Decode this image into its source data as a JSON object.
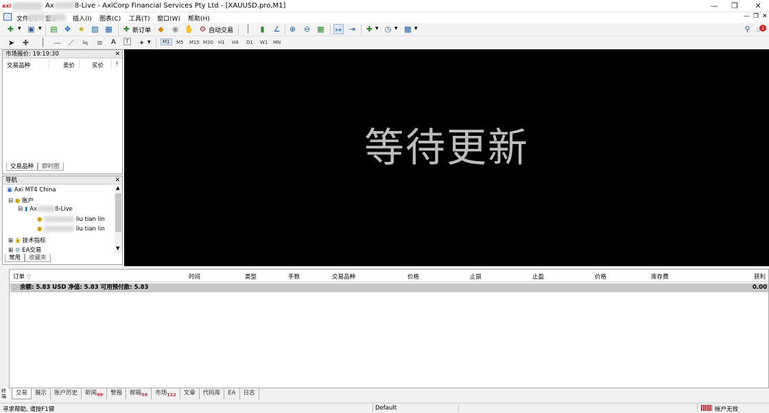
{
  "window": {
    "title": "Axi ... 8-Live - AxiCorp Financial Services Pty Ltd - [XAUUSD.pro,M1]",
    "title_visible": "8-Live - AxiCorp Financial Services Pty Ltd - [XAUUSD.pro,M1]",
    "title_prefix": "Ax",
    "app_logo": "axi"
  },
  "menu": {
    "items": [
      "文件(F)",
      "显示",
      "插入(I)",
      "图表(C)",
      "工具(T)",
      "窗口(W)",
      "帮助(H)"
    ]
  },
  "toolbar": {
    "new_order": "新订单",
    "auto_trade": "自动交易",
    "timeframes": [
      "M1",
      "M5",
      "M15",
      "M30",
      "H1",
      "H4",
      "D1",
      "W1",
      "MN"
    ],
    "notification_count": "1",
    "text_tool": "A"
  },
  "market_watch": {
    "title": "市场报价: 19:19:30",
    "columns": [
      "交易品种",
      "卖价",
      "买价",
      "!"
    ],
    "tabs": [
      "交易品种",
      "即时图"
    ]
  },
  "navigator": {
    "title": "导航",
    "root": "Axi MT4 China",
    "accounts_label": "账户",
    "account_name_suffix": "8-Live",
    "account_prefix": "Ax",
    "users": [
      "liu tian lin",
      "liu tian lin"
    ],
    "indicators": "技术指标",
    "ea": "EA交易",
    "tabs": [
      "常用",
      "收藏夹"
    ]
  },
  "chart": {
    "waiting_text": "等待更新"
  },
  "terminal": {
    "columns": [
      "订单",
      "时间",
      "类型",
      "手数",
      "交易品种",
      "价格",
      "止损",
      "止盈",
      "价格",
      "库存费",
      "获利"
    ],
    "balance_line": "余额: 5.83 USD  净值: 5.83  可用预付款: 5.83",
    "profit": "0.00",
    "side_label": "终端",
    "tabs": [
      {
        "label": "交易",
        "badge": ""
      },
      {
        "label": "展示",
        "badge": ""
      },
      {
        "label": "账户历史",
        "badge": ""
      },
      {
        "label": "新闻",
        "badge": "99"
      },
      {
        "label": "警报",
        "badge": ""
      },
      {
        "label": "邮箱",
        "badge": "59"
      },
      {
        "label": "市场",
        "badge": "112"
      },
      {
        "label": "文章",
        "badge": ""
      },
      {
        "label": "代码库",
        "badge": ""
      },
      {
        "label": "EA",
        "badge": ""
      },
      {
        "label": "日志",
        "badge": ""
      }
    ]
  },
  "statusbar": {
    "help": "寻求帮助, 请按F1键",
    "profile": "Default",
    "connection": "帐户无效"
  }
}
